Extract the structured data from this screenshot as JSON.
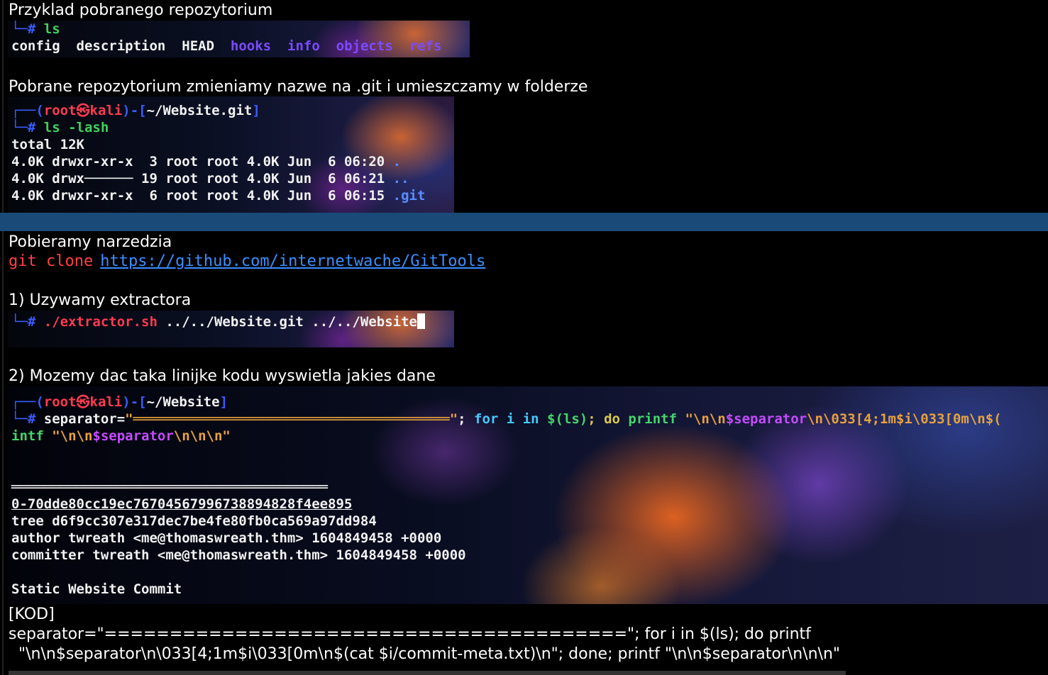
{
  "headings": {
    "h1": "Przyklad pobranego repozytorium",
    "h2": "Pobrane repozytorium zmieniamy nazwe na .git i umieszczamy w folderze",
    "h3": "Pobieramy narzedzia",
    "h4": "1) Uzywamy extractora",
    "h5": "2) Mozemy dac taka linijke kodu wyswietla jakies dane",
    "h6": "[KOD]"
  },
  "term1": {
    "prompt_line": "└─# ",
    "cmd": "ls",
    "items": [
      "config",
      "description",
      "HEAD",
      "hooks",
      "info",
      "objects",
      "refs"
    ]
  },
  "term2": {
    "l1_a": "┌──(",
    "l1_user": "root㉿kali",
    "l1_b": ")-[",
    "l1_path": "~/Website.git",
    "l1_c": "]",
    "l2_prompt": "└─# ",
    "l2_cmd": "ls -lash",
    "l3": "total 12K",
    "l4": "4.0K drwxr-xr-x  3 root root 4.0K Jun  6 06:20 ",
    "l4_name": ".",
    "l5": "4.0K drwx────── 19 root root 4.0K Jun  6 06:21 ",
    "l5_name": "..",
    "l6": "4.0K drwxr-xr-x  6 root root 4.0K Jun  6 06:15 ",
    "l6_name": ".git"
  },
  "git_clone": {
    "cmd": "git clone",
    "url": "https://github.com/internetwache/GitTools"
  },
  "term3": {
    "prompt": "└─# ",
    "cmd": "./extractor.sh",
    "args": " ../../Website.git ../../Website"
  },
  "term4": {
    "l1_a": "┌──(",
    "l1_user": "root㉿kali",
    "l1_b": ")-[",
    "l1_path": "~/Website",
    "l1_c": "]",
    "l2_prompt": "└─# ",
    "l2_sep": "separator=",
    "l2_str": "\"═══════════════════════════════════════\"",
    "l2_semi": "; ",
    "l2_for": "for i in ",
    "l2_ls": "$(ls)",
    "l2_do": "; do ",
    "l2_printf": "printf ",
    "l2_q1": "\"\\n\\n",
    "l2_var": "$separator",
    "l2_rest": "\\n\\033[4;1m$i\\033[0m\\n$(",
    "l3_a": "intf ",
    "l3_b": "\"\\n\\n",
    "l3_var": "$separator",
    "l3_c": "\\n\\n\\n\"",
    "rule": "═══════════════════════════════════════",
    "commit": "0-70dde80cc19ec76704567996738894828f4ee895",
    "tree": "tree d6f9cc307e317dec7be4fe80fb0ca569a97dd984",
    "author": "author twreath <me@thomaswreath.thm> 1604849458 +0000",
    "committer": "committer twreath <me@thomaswreath.thm> 1604849458 +0000",
    "message": "Static Website Commit"
  },
  "kod": {
    "line1": "separator=\"========================================\"; for i in $(ls); do printf",
    "line2": "  \"\\n\\n$separator\\n\\033[4;1m$i\\033[0m\\n$(cat $i/commit-meta.txt)\\n\"; done; printf \"\\n\\n$separator\\n\\n\\n\""
  }
}
